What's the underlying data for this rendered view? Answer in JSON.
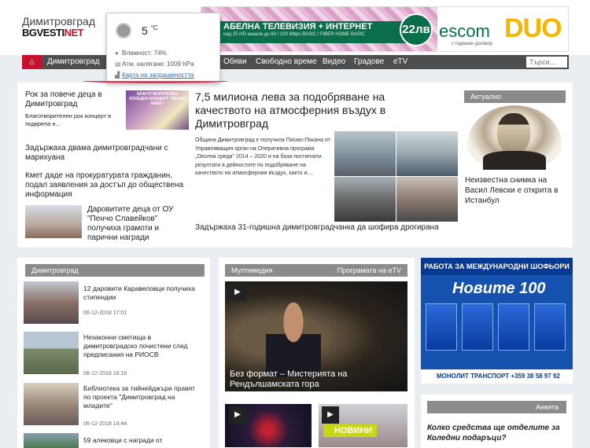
{
  "logo": {
    "line1": "Димитровград",
    "bg": "BG",
    "vesti": "VESTI",
    "net": "NET"
  },
  "banner": {
    "strip_title": "АБЕЛНА ТЕЛЕВИЗИЯ + ИНТЕРНЕТ",
    "strip_sub": "над 25 HD канали до 60 / 100 Mbps BASIC / FIBER HOME BASIC",
    "price": "22лв",
    "escom": "escom",
    "duo": "DUO",
    "sub": "с годишен договор"
  },
  "weather": {
    "temp": "5",
    "unit": "°C",
    "humidity": "Влажност: 74%",
    "pressure": "Атм. налягане: 1009 hPa",
    "map_link": "Карта на запрашеността"
  },
  "nav": {
    "items": [
      "Димитровград",
      "Обяви",
      "Свободно време",
      "Видео",
      "Градове",
      "eTV"
    ],
    "search_placeholder": "Търси..."
  },
  "top_news": {
    "left": [
      {
        "title": "Рок за повече деца в Димитровград",
        "text": "Благотворителен рок концерт в подкрепа н..."
      },
      {
        "title": "Задържаха двама димитровградчани с марихуана"
      },
      {
        "title": "Кмет даде на прокуратурата гражданин, подал заявления за достъп до обществена информация"
      },
      {
        "title": "Даровитите деца от ОУ \"Пенчо Славейков\" получиха грамоти и парични награди"
      }
    ],
    "concert_thumb_text": "БЛАГОТВОРИТЕЛЕН КОЛЕДЕН КОНЦЕРТ \"ИСКАМ БЕБЕ\"",
    "headline": "7,5 милиона лева за подобряване на качеството на атмосферния въздух в Димитровград",
    "lead": "Община Димитровград е получила Писмо-Покана от Управляващия орган на Оперативна програма „Околна среда\" 2014 – 2020 и на база постигнати резултати в дейностите по подобряване на качеството на атмосферния въздух, както и....",
    "sub": "Задържаха 31-годишна димитровградчанка да шофира дрогирана"
  },
  "actual": {
    "heading": "Актуално",
    "text": "Неизвестна снимка на Васил Левски е открита в Истанбул"
  },
  "dimitrovgrad": {
    "heading": "Димитровград",
    "items": [
      {
        "title": "12 даровити Каравеловци получиха стипендии",
        "date": "06-12-2018 17:01"
      },
      {
        "title": "Незаконни сметища в димитровградско почистени след предписания на РИОСВ",
        "date": "06-12-2018 16:16"
      },
      {
        "title": "Библиотека за тийнейджъри правят по проекта \"Димитровград на младите\"",
        "date": "06-12-2018 14:44"
      },
      {
        "title": "59 алековци с награди от",
        "date": ""
      }
    ]
  },
  "multimedia": {
    "heading": "Мултимедия",
    "program": "Програмата на eTV",
    "title": "Без формат – Мистерията на Рендълшамската гора",
    "novini": "НОВИНИ"
  },
  "ad_right": {
    "top": "РАБОТА ЗА МЕЖДУНАРОДНИ ШОФЬОРИ",
    "new100": "Новите 100",
    "bottom": "МОНОЛИТ ТРАНСПОРТ +359 38 58 97 92"
  },
  "poll": {
    "heading": "Анкета",
    "question": "Колко средства ще отделите за Коледни подаръци?"
  },
  "colors": {
    "accent_red": "#c8102e",
    "nav_bg": "#4e4e4e",
    "section_gray": "#8b8b8b",
    "link_blue": "#2a6ebb"
  }
}
